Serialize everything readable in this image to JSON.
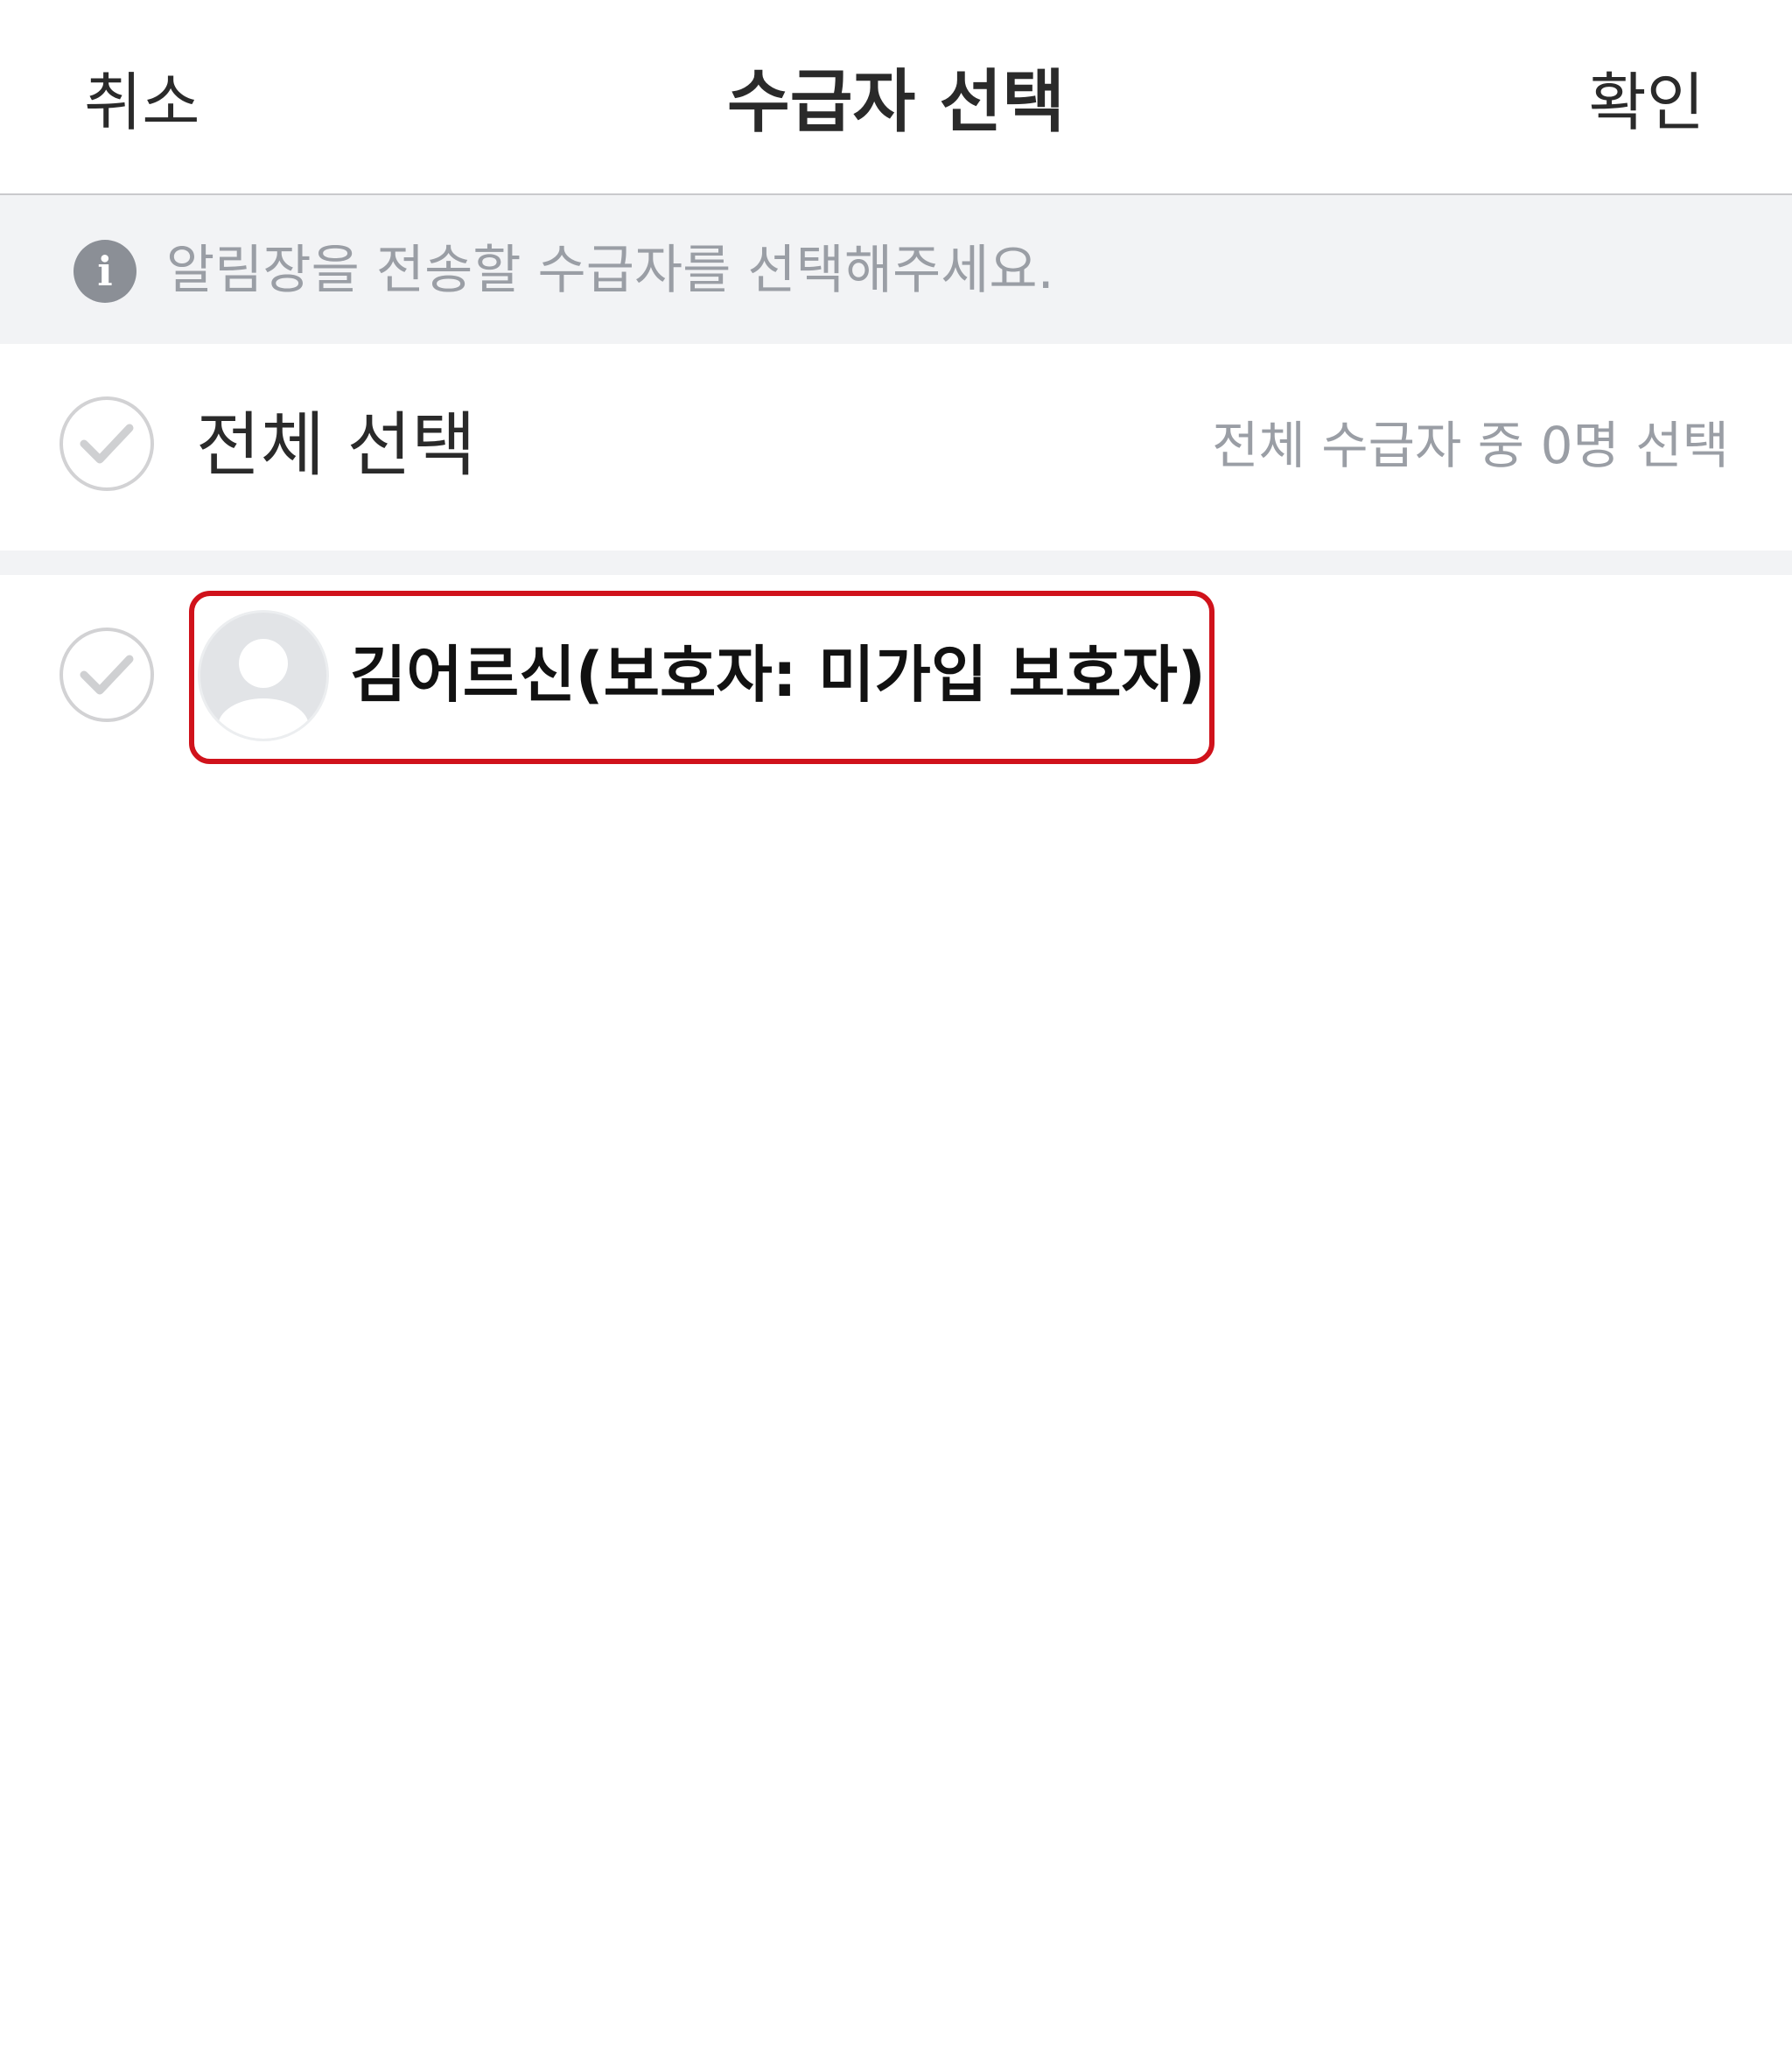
{
  "header": {
    "cancel_label": "취소",
    "title": "수급자 선택",
    "confirm_label": "확인"
  },
  "notice": {
    "icon": "info-icon",
    "text": "알림장을 전송할 수급자를 선택해주세요."
  },
  "select_all": {
    "label": "전체 선택",
    "count_text": "전체 수급자 중 0명 선택",
    "checked": false
  },
  "recipients": [
    {
      "name": "김어르신(보호자: 미가입 보호자)",
      "avatar": "default-person-avatar",
      "checked": false,
      "highlighted": true
    }
  ],
  "colors": {
    "highlight_border": "#d0121b",
    "muted_text": "#9a9ea5",
    "notice_background": "#f2f3f5",
    "check_border": "#d2d2d4"
  }
}
